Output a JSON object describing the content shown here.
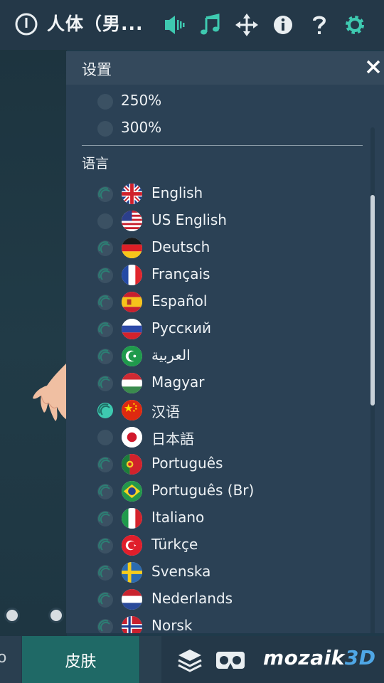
{
  "header": {
    "title": "人体（男..."
  },
  "settings": {
    "title": "设置",
    "zoom_options": [
      {
        "label": "250%",
        "selected": false
      },
      {
        "label": "300%",
        "selected": false
      }
    ],
    "language_section": "语言",
    "languages": [
      {
        "label": "English",
        "selected": false
      },
      {
        "label": "US English",
        "selected": false
      },
      {
        "label": "Deutsch",
        "selected": false
      },
      {
        "label": "Français",
        "selected": false
      },
      {
        "label": "Español",
        "selected": false
      },
      {
        "label": "Русский",
        "selected": false
      },
      {
        "label": "العربية",
        "selected": false
      },
      {
        "label": "Magyar",
        "selected": false
      },
      {
        "label": "汉语",
        "selected": true
      },
      {
        "label": "日本語",
        "selected": false
      },
      {
        "label": "Português",
        "selected": false
      },
      {
        "label": "Português (Br)",
        "selected": false
      },
      {
        "label": "Italiano",
        "selected": false
      },
      {
        "label": "Türkçe",
        "selected": false
      },
      {
        "label": "Svenska",
        "selected": false
      },
      {
        "label": "Nederlands",
        "selected": false
      },
      {
        "label": "Norsk",
        "selected": false
      }
    ]
  },
  "bottom": {
    "left_tab": "o",
    "skin_tab": "皮肤",
    "brand_main": "mozaik",
    "brand_accent": "3D"
  },
  "colors": {
    "accent": "#3ec9b0",
    "panel_bg": "#2b4155",
    "topbar_bg": "#243848"
  }
}
